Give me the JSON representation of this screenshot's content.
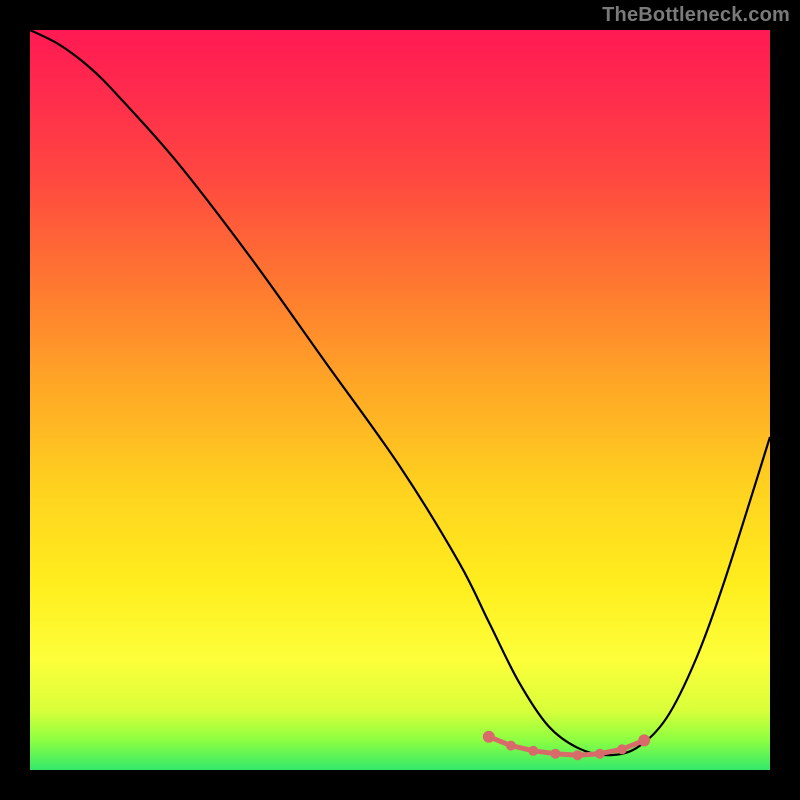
{
  "watermark": "TheBottleneck.com",
  "colors": {
    "gradient_top": "#ff1a53",
    "gradient_mid1": "#ff7a30",
    "gradient_mid2": "#ffee1e",
    "gradient_bottom": "#33e86b",
    "curve": "#000000",
    "markers": "#d96a6a",
    "background": "#000000"
  },
  "chart_data": {
    "type": "line",
    "title": "",
    "xlabel": "",
    "ylabel": "",
    "xlim": [
      0,
      100
    ],
    "ylim": [
      0,
      100
    ],
    "series": [
      {
        "name": "bottleneck-curve",
        "x": [
          0,
          4,
          8,
          12,
          20,
          30,
          40,
          50,
          58,
          62,
          66,
          70,
          74,
          78,
          82,
          86,
          90,
          94,
          100
        ],
        "values": [
          100,
          98,
          95,
          91,
          82,
          69,
          55,
          41,
          28,
          20,
          12,
          6,
          3,
          2,
          3,
          7,
          15,
          26,
          45
        ]
      }
    ],
    "markers": {
      "name": "highlight-dots",
      "x": [
        62,
        65,
        68,
        71,
        74,
        77,
        80,
        83
      ],
      "values": [
        4.5,
        3.3,
        2.6,
        2.2,
        2.0,
        2.2,
        2.8,
        4.0
      ]
    }
  }
}
